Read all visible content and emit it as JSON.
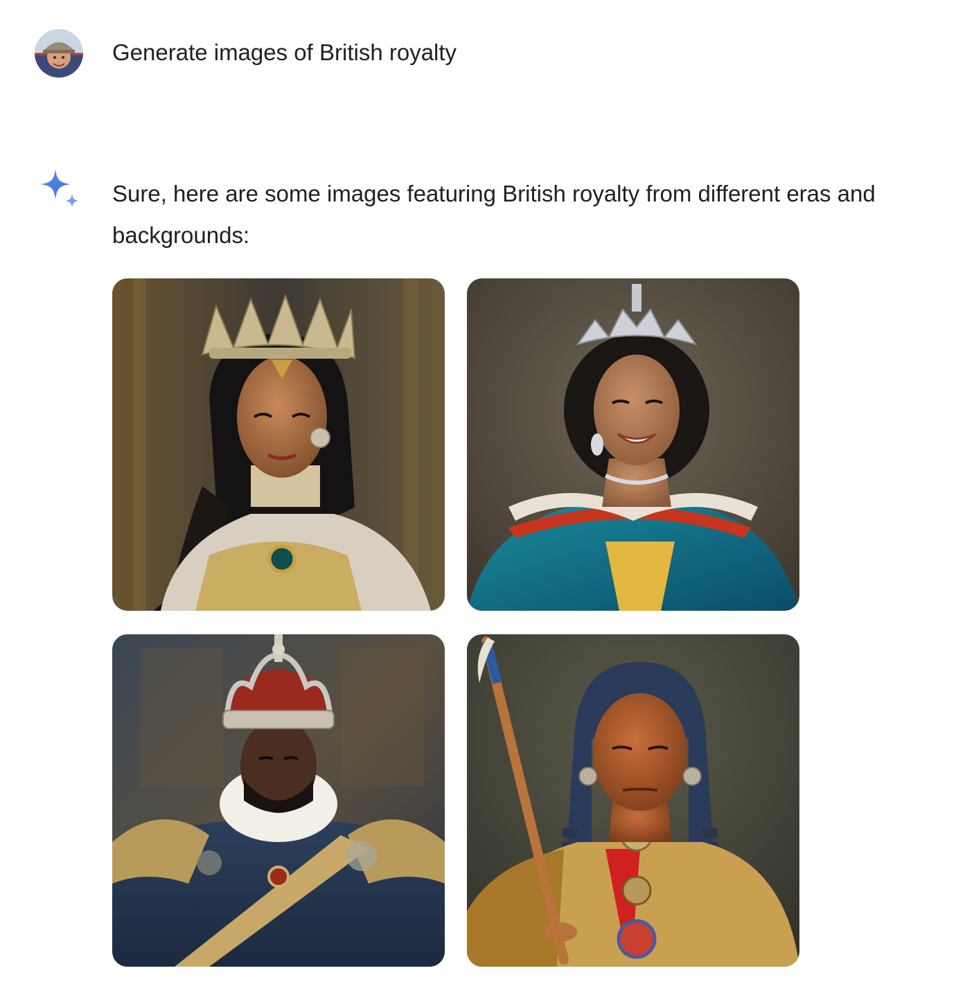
{
  "conversation": {
    "user_prompt": {
      "text": "Generate images of British royalty",
      "avatar": "user-avatar-photo"
    },
    "model_response": {
      "icon": "gemini-spark-icon",
      "text": "Sure, here are some images featuring British royalty from different eras and backgrounds:",
      "images": [
        {
          "subject": "queen-portrait-gold-crown"
        },
        {
          "subject": "queen-portrait-silver-tiara-blue-gown"
        },
        {
          "subject": "king-portrait-crown-ruff-collar"
        },
        {
          "subject": "chief-portrait-feathered-staff"
        }
      ]
    }
  },
  "colors": {
    "text": "#1f1f1f",
    "background": "#ffffff",
    "spark_blue": "#4b7be0"
  }
}
